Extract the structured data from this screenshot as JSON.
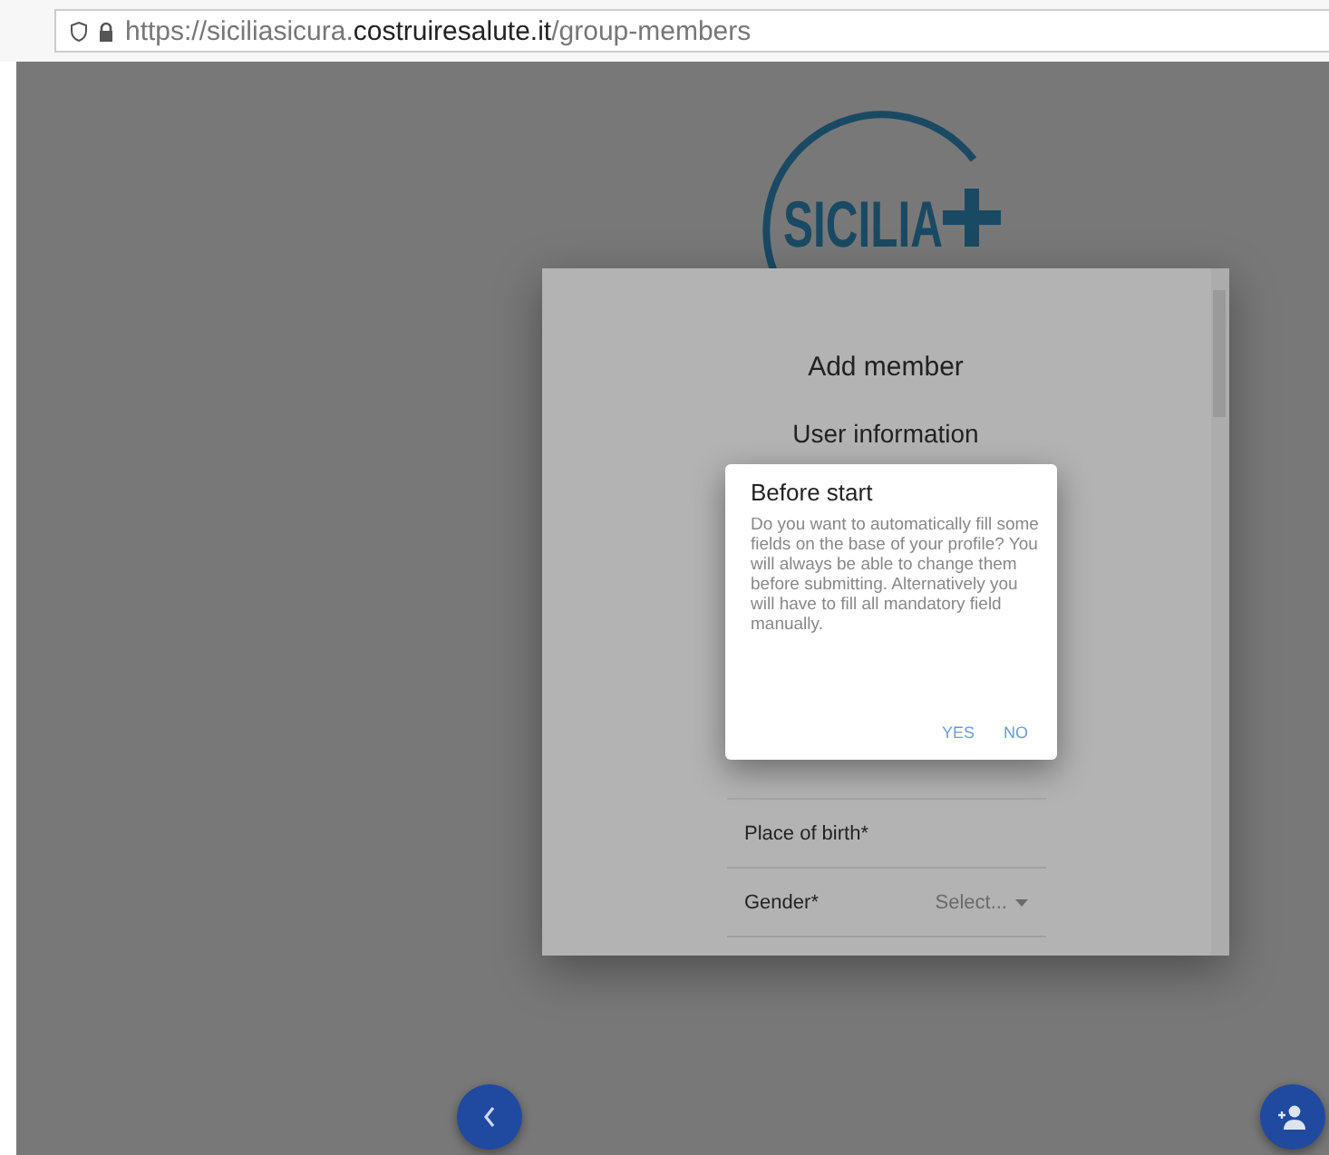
{
  "browser": {
    "url": "https://siciliasicura.**costruiresalute.it**/group-members"
  },
  "logo": {
    "text": "SICILIA"
  },
  "modal": {
    "title": "Add member",
    "section": "User information",
    "fields": [
      {
        "kind": "text",
        "label": "Place of birth*"
      },
      {
        "kind": "select",
        "label": "Gender*",
        "placeholder": "Select..."
      }
    ]
  },
  "dialog": {
    "title": "Before start",
    "message": "Do you want to automatically fill some fields on the base of your profile? You will always be able to change them before submitting. Alternatively you will have to fill all mandatory field manually.",
    "buttons": [
      "YES",
      "NO"
    ]
  }
}
